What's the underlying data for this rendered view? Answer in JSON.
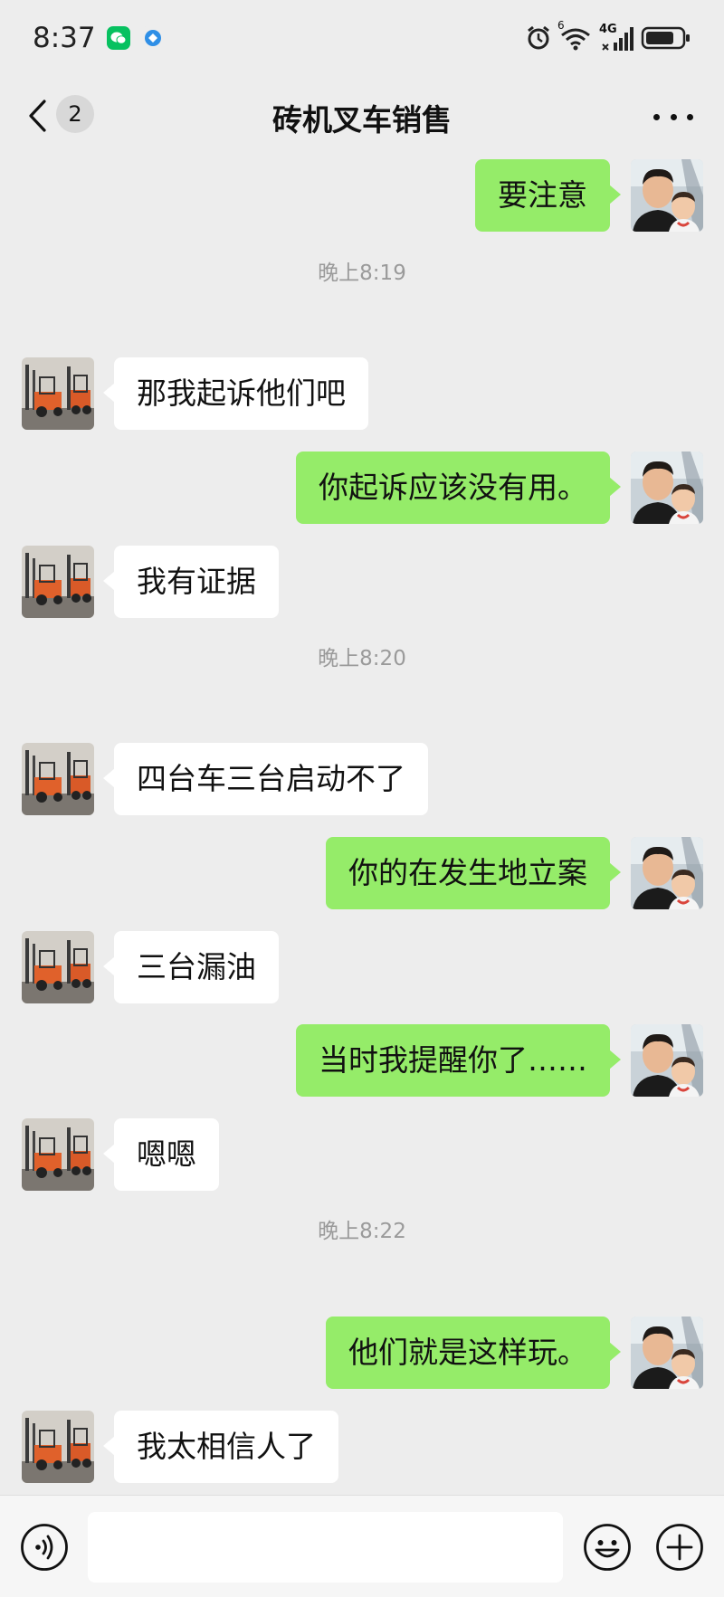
{
  "status_bar": {
    "time": "8:37",
    "network_label": "4G",
    "wifi_sub": "6"
  },
  "header": {
    "unread_count": "2",
    "title": "砖机叉车销售"
  },
  "messages": [
    {
      "sender": "me",
      "text": "要注意"
    },
    {
      "type": "time",
      "text": "晚上8:19"
    },
    {
      "sender": "them",
      "text": "那我起诉他们吧"
    },
    {
      "sender": "me",
      "text": "你起诉应该没有用。"
    },
    {
      "sender": "them",
      "text": "我有证据"
    },
    {
      "type": "time",
      "text": "晚上8:20"
    },
    {
      "sender": "them",
      "text": "四台车三台启动不了"
    },
    {
      "sender": "me",
      "text": "你的在发生地立案"
    },
    {
      "sender": "them",
      "text": "三台漏油"
    },
    {
      "sender": "me",
      "text": "当时我提醒你了……"
    },
    {
      "sender": "them",
      "text": "嗯嗯"
    },
    {
      "type": "time",
      "text": "晚上8:22"
    },
    {
      "sender": "me",
      "text": "他们就是这样玩。"
    },
    {
      "sender": "them",
      "text": "我太相信人了"
    }
  ],
  "input_bar": {
    "value": "",
    "placeholder": ""
  },
  "colors": {
    "background": "#ededed",
    "my_bubble": "#95ec69",
    "their_bubble": "#ffffff",
    "timestamp": "#9a9a9a"
  }
}
